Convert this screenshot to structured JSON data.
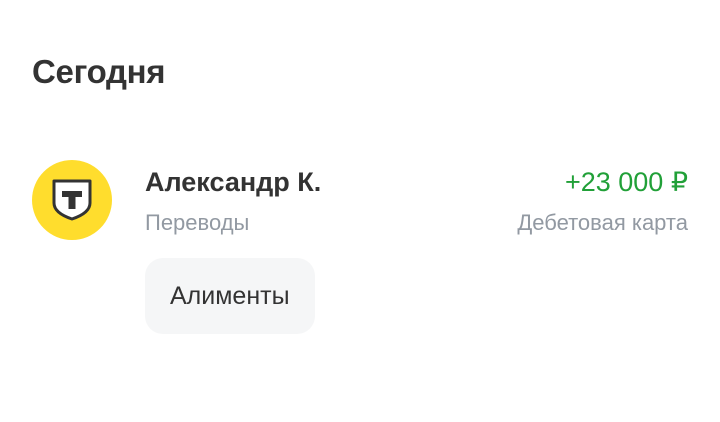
{
  "section": {
    "title": "Сегодня"
  },
  "transaction": {
    "name": "Александр К.",
    "category": "Переводы",
    "amount": "+23 000 ₽",
    "account": "Дебетовая карта",
    "tag": "Алименты",
    "avatar_icon": "bank-logo-icon",
    "colors": {
      "avatar_bg": "#ffdd2d",
      "amount": "#21a038",
      "secondary_text": "#9299a2",
      "tag_bg": "#f5f6f7"
    }
  }
}
